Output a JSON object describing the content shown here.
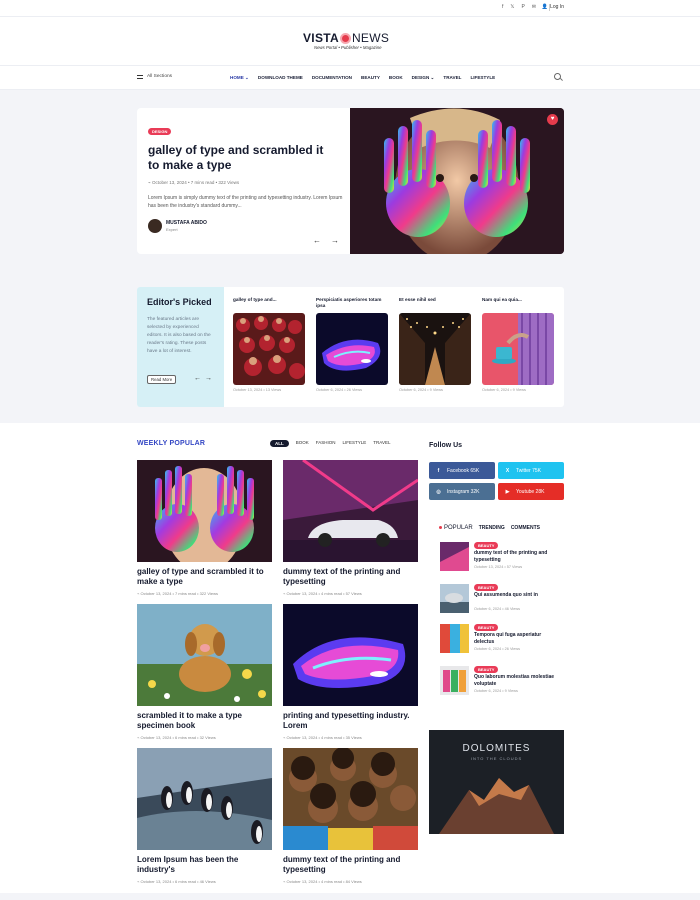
{
  "topbar": {
    "login": "Log In",
    "social_icons": [
      "facebook-icon",
      "x-icon",
      "pinterest-icon",
      "mail-icon"
    ]
  },
  "logo": {
    "part1": "VISTA",
    "part2": "NEWS",
    "tagline": "News Portal  •  Publisher  •  Magazine"
  },
  "nav": {
    "all_sections": "All Sections",
    "items": [
      "HOME ⌄",
      "DOWNLOAD THEME",
      "DOCUMENTATION",
      "BEAUTY",
      "BOOK",
      "DESIGN ⌄",
      "TRAVEL",
      "LIFESTYLE"
    ]
  },
  "hero": {
    "badge": "DESIGN",
    "title": "galley of type and scrambled it to make a type",
    "meta": "⌁ October 13, 2024   •   7 mins read   •   322 Views",
    "desc": "Lorem Ipsum is simply dummy text of the printing and typesetting industry. Lorem Ipsum has been the industry's standard dummy...",
    "author": "MUSTAFA ABIDO",
    "role": "Expert",
    "prev": "←",
    "next": "→"
  },
  "editors": {
    "heading": "Editor's Picked",
    "text": "The featured articles are selected by experienced editors. It is also based on the reader's rating. These posts have a lot of interest.",
    "more": "Read More",
    "cards": [
      {
        "title": "galley of type and...",
        "meta": "October 13, 2024   •   13 Views"
      },
      {
        "title": "Perspiciatis asperiores totam ipsa",
        "meta": "October 6, 2024   •   26 Views"
      },
      {
        "title": "Et esse nihil sed",
        "meta": "October 6, 2024   •   9 Views"
      },
      {
        "title": "Nam qui ea quia...",
        "meta": "October 6, 2024   •   9 Views"
      }
    ]
  },
  "weekly": {
    "heading": "WEEKLY POPULAR",
    "filters": [
      "ALL",
      "BOOK",
      "FASHION",
      "LIFESTYLE",
      "TRAVEL"
    ],
    "cards": [
      {
        "title": "galley of type and scrambled it to make a type",
        "meta": "⌁ October 13, 2024   •   7 mins read   •   322 Views"
      },
      {
        "title": "dummy text of the printing and typesetting",
        "meta": "⌁ October 13, 2024   •   4 mins read   •   57 Views"
      },
      {
        "title": "scrambled it to make a type specimen book",
        "meta": "⌁ October 13, 2024   •   6 mins read   •   32 Views"
      },
      {
        "title": "printing and typesetting industry. Lorem",
        "meta": "⌁ October 13, 2024   •   4 mins read   •   35 Views"
      },
      {
        "title": "Lorem Ipsum has been the industry's",
        "meta": "⌁ October 13, 2024   •   6 mins read   •   46 Views"
      },
      {
        "title": "dummy text of the printing and typesetting",
        "meta": "⌁ October 13, 2024   •   4 mins read   •   84 Views"
      }
    ]
  },
  "sidebar": {
    "follow": "Follow Us",
    "social": [
      {
        "label": "Facebook 65K",
        "icon": "f",
        "color": "#3b5998"
      },
      {
        "label": "Twitter 75K",
        "icon": "X",
        "color": "#1fc3f0"
      },
      {
        "label": "Instagram 32K",
        "icon": "◎",
        "color": "#4b6f93"
      },
      {
        "label": "Youtube 28K",
        "icon": "▶",
        "color": "#e52d27"
      }
    ],
    "tabs": [
      "POPULAR",
      "TRENDING",
      "COMMENTS"
    ],
    "popular": [
      {
        "badge": "BEAUTY",
        "title": "dummy text of the printing and typesetting",
        "meta": "October 13, 2024   •   57 Views"
      },
      {
        "badge": "BEAUTY",
        "title": "Qui assumenda quo sint in",
        "meta": "October 6, 2024   •   46 Views"
      },
      {
        "badge": "BEAUTY",
        "title": "Tempora qui fuga asperiatur delectus",
        "meta": "October 6, 2024   •   26 Views"
      },
      {
        "badge": "BEAUTY",
        "title": "Quo laborum molestias molestiae voluptate",
        "meta": "October 6, 2024   •   9 Views"
      }
    ],
    "ad_title": "DOLOMITES",
    "ad_sub": "INTO THE CLOUDS"
  }
}
